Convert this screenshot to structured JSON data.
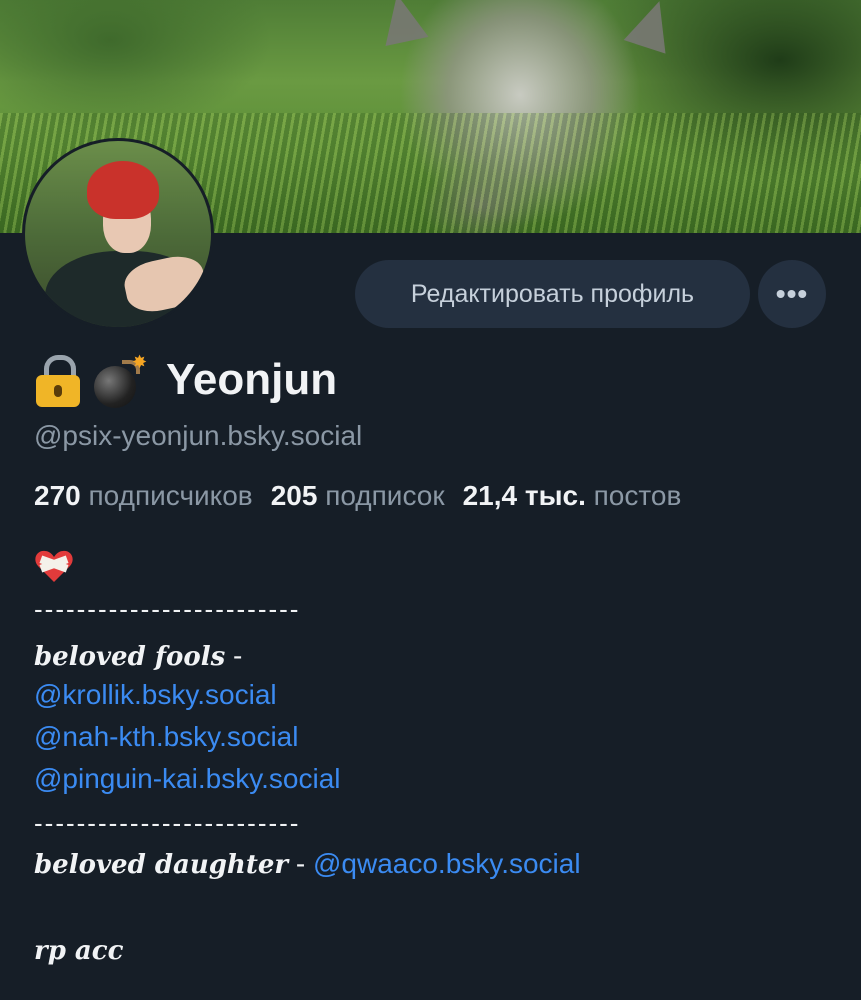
{
  "profile": {
    "display_name": "Yeonjun",
    "handle": "@psix-yeonjun.bsky.social",
    "name_emojis": [
      "lock-icon",
      "bomb-icon"
    ]
  },
  "actions": {
    "edit_label": "Редактировать профиль",
    "more_label": "•••"
  },
  "stats": [
    {
      "num": "270",
      "label": "подписчиков"
    },
    {
      "num": "205",
      "label": "подписок"
    },
    {
      "num": "21,4 тыс.",
      "label": "постов"
    }
  ],
  "bio": {
    "emoji": "mending-heart-icon",
    "divider1": "-------------------------",
    "fools_label": "beloved fools",
    "fools_sep": " -",
    "fools": [
      "@krollik.bsky.social",
      "@nah-kth.bsky.social",
      "@pinguin-kai.bsky.social"
    ],
    "divider2": "-------------------------",
    "daughter_label": "beloved daughter",
    "daughter_sep": " - ",
    "daughter": "@qwaaco.bsky.social",
    "footer": "rp acc"
  },
  "colors": {
    "background": "#161e27",
    "button_bg": "#243040",
    "link": "#3b8bf2",
    "muted": "#8b98a5"
  }
}
